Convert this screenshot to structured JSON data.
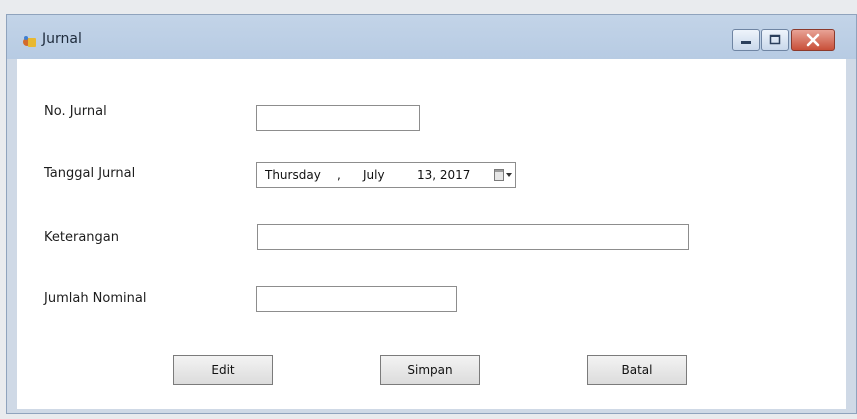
{
  "window": {
    "title": "Jurnal",
    "icon": "app-icon"
  },
  "form": {
    "no_jurnal": {
      "label": "No. Jurnal",
      "value": ""
    },
    "tanggal_jurnal": {
      "label": "Tanggal Jurnal",
      "day": "Thursday",
      "sep": ",",
      "month": "July",
      "date_year": "13, 2017"
    },
    "keterangan": {
      "label": "Keterangan",
      "value": ""
    },
    "jumlah_nominal": {
      "label": "Jumlah Nominal",
      "value": ""
    }
  },
  "buttons": {
    "edit": "Edit",
    "simpan": "Simpan",
    "batal": "Batal"
  }
}
